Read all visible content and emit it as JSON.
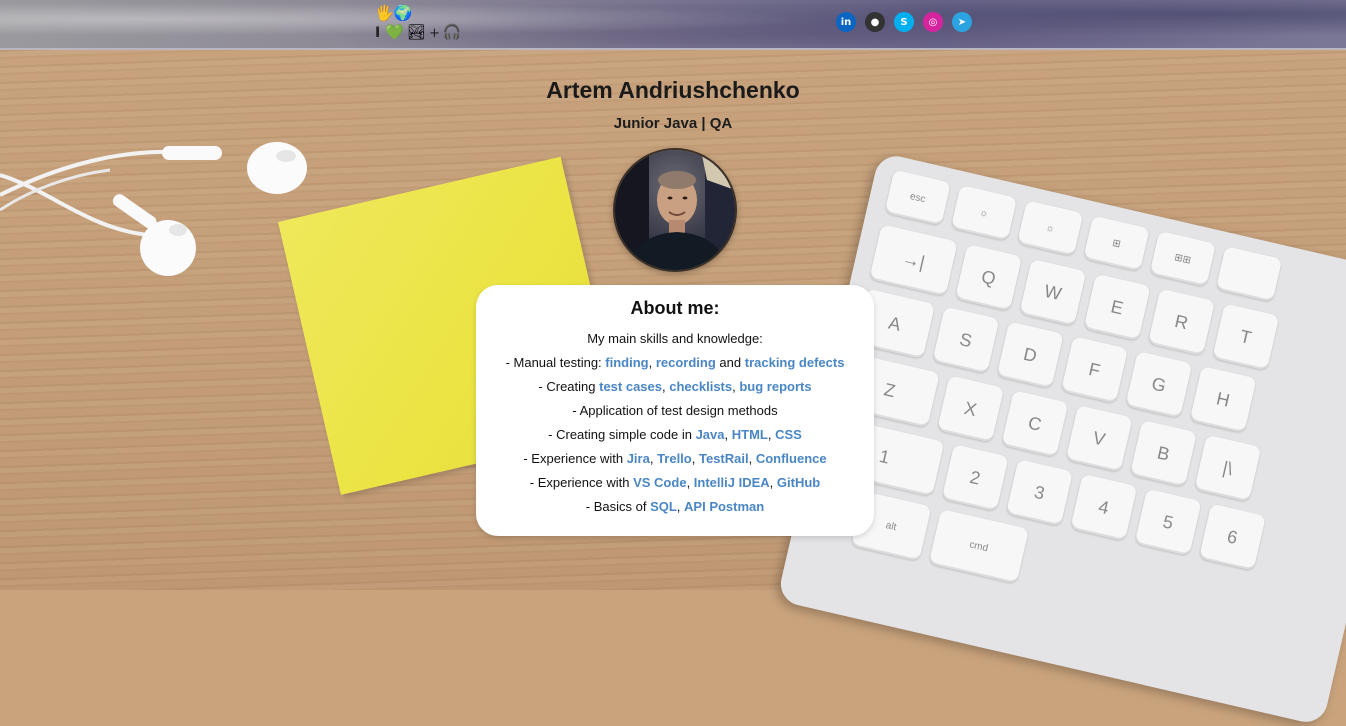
{
  "header": {
    "badge": {
      "row1": [
        "🖐",
        "🌍"
      ],
      "i_text": "I",
      "heart": "💚",
      "image_emoji": "🏞",
      "plus": "+",
      "headphones": "🎧"
    },
    "socials": [
      {
        "icon": "linkedin-icon",
        "glyph": "in",
        "color": "#0a66c2"
      },
      {
        "icon": "github-icon",
        "glyph": "●",
        "color": "#333333"
      },
      {
        "icon": "skype-icon",
        "glyph": "S",
        "color": "#00aff0"
      },
      {
        "icon": "instagram-icon",
        "glyph": "◎",
        "color": "#d6249f"
      },
      {
        "icon": "telegram-icon",
        "glyph": "➤",
        "color": "#2aa3e0"
      }
    ]
  },
  "profile": {
    "name": "Artem Andriushchenko",
    "role": "Junior Java | QA"
  },
  "about": {
    "title": "About me:",
    "lines": [
      [
        {
          "t": "My main skills and knowledge:"
        }
      ],
      [
        {
          "t": "- Manual testing: "
        },
        {
          "t": "finding",
          "link": true
        },
        {
          "t": ", "
        },
        {
          "t": "recording",
          "link": true
        },
        {
          "t": " and "
        },
        {
          "t": "tracking defects",
          "link": true
        }
      ],
      [
        {
          "t": "- Creating "
        },
        {
          "t": "test cases",
          "link": true
        },
        {
          "t": ", "
        },
        {
          "t": "checklists",
          "link": true
        },
        {
          "t": ", "
        },
        {
          "t": "bug reports",
          "link": true
        }
      ],
      [
        {
          "t": "- Application of test design methods"
        }
      ],
      [
        {
          "t": "- Creating simple code in "
        },
        {
          "t": "Java",
          "link": true
        },
        {
          "t": ", "
        },
        {
          "t": "HTML",
          "link": true
        },
        {
          "t": ", "
        },
        {
          "t": "CSS",
          "link": true
        }
      ],
      [
        {
          "t": "- Experience with "
        },
        {
          "t": "Jira",
          "link": true
        },
        {
          "t": ", "
        },
        {
          "t": "Trello",
          "link": true
        },
        {
          "t": ", "
        },
        {
          "t": "TestRail",
          "link": true
        },
        {
          "t": ", "
        },
        {
          "t": "Confluence",
          "link": true
        }
      ],
      [
        {
          "t": "- Experience with "
        },
        {
          "t": "VS Code",
          "link": true
        },
        {
          "t": ", "
        },
        {
          "t": "IntelliJ IDEA",
          "link": true
        },
        {
          "t": ", "
        },
        {
          "t": "GitHub",
          "link": true
        }
      ],
      [
        {
          "t": "- Basics of "
        },
        {
          "t": "SQL",
          "link": true
        },
        {
          "t": ", "
        },
        {
          "t": "API Postman",
          "link": true
        }
      ]
    ]
  },
  "keyboard": {
    "keys": [
      "esc",
      "☼",
      "☼",
      "⊞",
      "⊞⊞",
      "",
      "→|",
      "Q",
      "W",
      "E",
      "R",
      "T",
      "A",
      "S",
      "D",
      "F",
      "G",
      "H",
      "Z",
      "X",
      "C",
      "V",
      "B",
      "|\\",
      "1",
      "2",
      "3",
      "4",
      "5",
      "6",
      "alt",
      "cmd"
    ]
  }
}
